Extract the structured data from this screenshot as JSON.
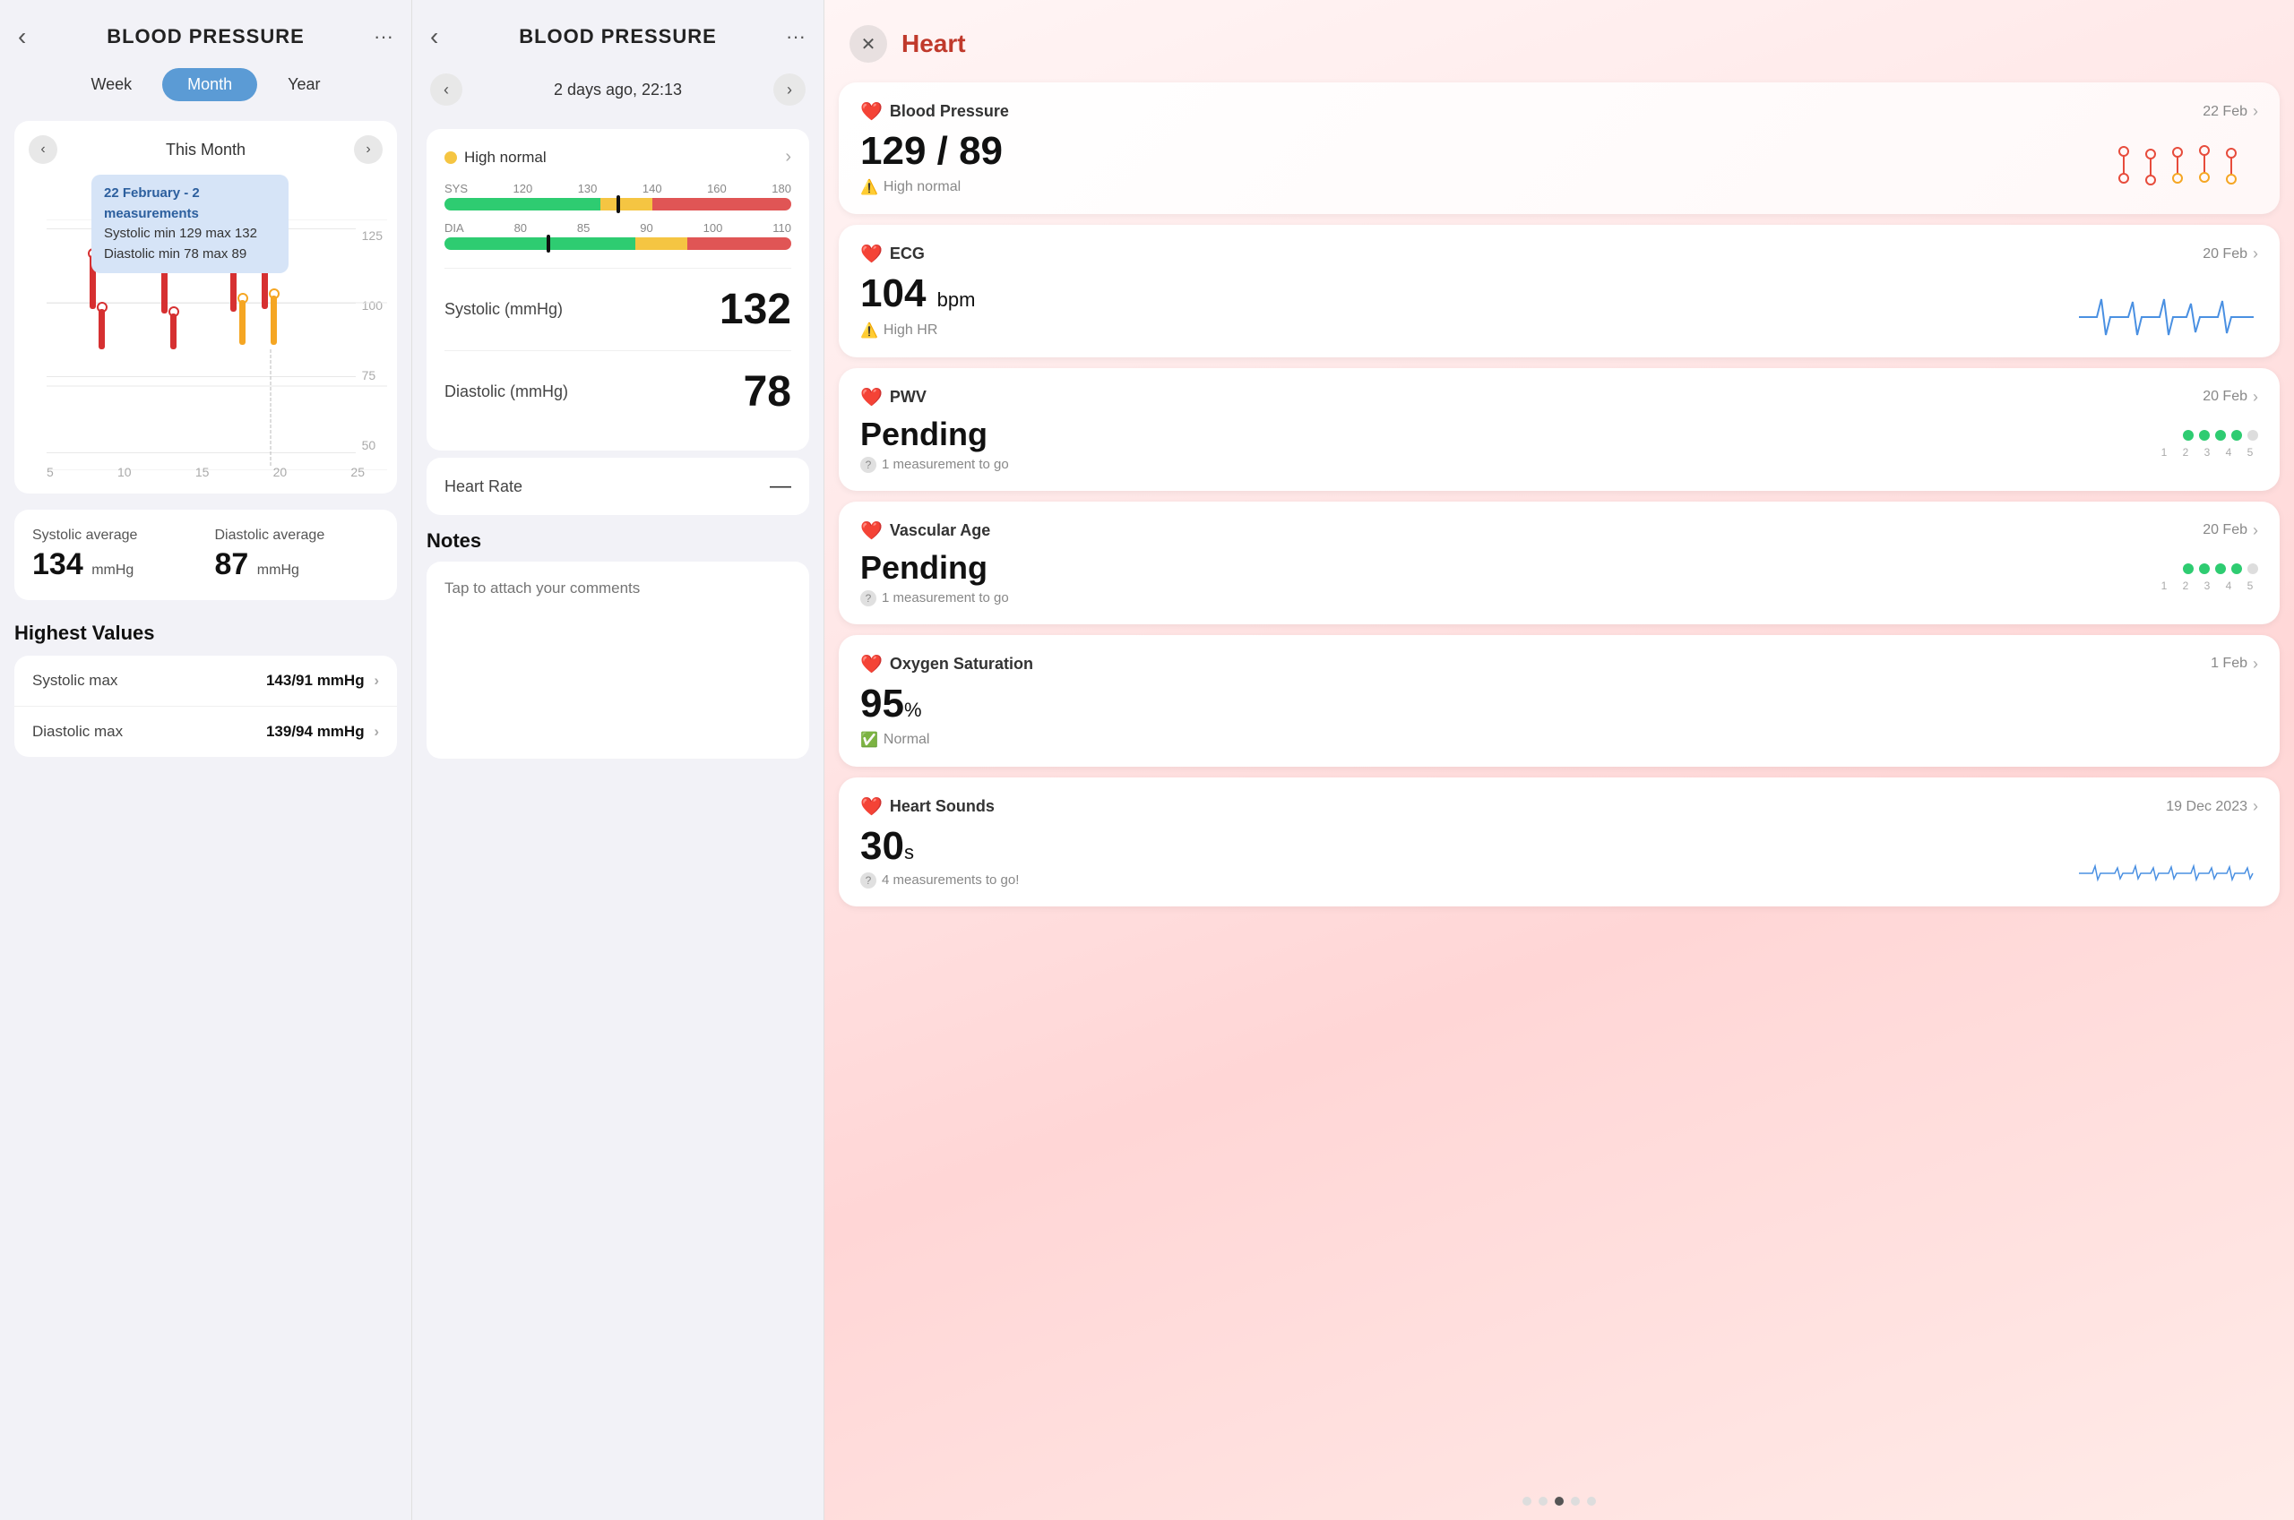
{
  "panel_left": {
    "back_label": "‹",
    "title": "BLOOD PRESSURE",
    "more_label": "···",
    "tabs": [
      {
        "label": "Week",
        "active": false
      },
      {
        "label": "Month",
        "active": true
      },
      {
        "label": "Year",
        "active": false
      }
    ],
    "chart_prev": "‹",
    "chart_next": "›",
    "chart_title": "This Month",
    "tooltip": {
      "date": "22 February - 2 measurements",
      "systolic": "Systolic min 129 max 132",
      "diastolic": "Diastolic min 78 max 89"
    },
    "y_labels": [
      "125",
      "100",
      "75",
      "50"
    ],
    "x_labels": [
      "5",
      "10",
      "15",
      "20",
      "25"
    ],
    "stats": {
      "systolic_label": "Systolic average",
      "systolic_value": "134",
      "systolic_unit": "mmHg",
      "diastolic_label": "Diastolic average",
      "diastolic_value": "87",
      "diastolic_unit": "mmHg"
    },
    "highest_title": "Highest Values",
    "highest_rows": [
      {
        "label": "Systolic max",
        "value": "143/91 mmHg"
      },
      {
        "label": "Diastolic max",
        "value": "139/94 mmHg"
      }
    ]
  },
  "panel_middle": {
    "back_label": "‹",
    "title": "BLOOD PRESSURE",
    "more_label": "···",
    "nav_prev": "‹",
    "nav_next": "›",
    "nav_date": "2 days ago, 22:13",
    "status_label": "High normal",
    "sys_label": "SYS",
    "dia_label": "DIA",
    "gauge_sys_ticks": [
      "80",
      "85",
      "90",
      "100",
      "110"
    ],
    "gauge_dia_ticks": [
      "120",
      "130",
      "140",
      "160",
      "180"
    ],
    "systolic_label": "Systolic (mmHg)",
    "systolic_value": "132",
    "diastolic_label": "Diastolic (mmHg)",
    "diastolic_value": "78",
    "heart_rate_label": "Heart Rate",
    "heart_rate_value": "—",
    "notes_title": "Notes",
    "notes_placeholder": "Tap to attach your comments"
  },
  "panel_right": {
    "close_label": "✕",
    "title": "Heart",
    "metrics": [
      {
        "id": "blood-pressure",
        "icon": "❤️",
        "name": "Blood Pressure",
        "date": "22 Feb",
        "value": "129 / 89",
        "status_icon": "⚠️",
        "status": "High normal",
        "has_chart": true
      },
      {
        "id": "ecg",
        "icon": "❤️",
        "name": "ECG",
        "date": "20 Feb",
        "value": "104",
        "unit": "bpm",
        "status_icon": "⚠️",
        "status": "High HR",
        "has_wave": true
      },
      {
        "id": "pwv",
        "icon": "❤️",
        "name": "PWV",
        "date": "20 Feb",
        "value": "Pending",
        "info": "1 measurement to go",
        "dots_filled": 4,
        "dots_total": 5,
        "dot_labels": [
          "1",
          "2",
          "3",
          "4",
          "5"
        ]
      },
      {
        "id": "vascular-age",
        "icon": "❤️",
        "name": "Vascular Age",
        "date": "20 Feb",
        "value": "Pending",
        "info": "1 measurement to go",
        "dots_filled": 4,
        "dots_total": 5,
        "dot_labels": [
          "1",
          "2",
          "3",
          "4",
          "5"
        ]
      },
      {
        "id": "oxygen-saturation",
        "icon": "❤️",
        "name": "Oxygen Saturation",
        "date": "1 Feb",
        "value": "95",
        "unit": "%",
        "status_icon": "✅",
        "status": "Normal"
      },
      {
        "id": "heart-sounds",
        "icon": "❤️",
        "name": "Heart Sounds",
        "date": "19 Dec 2023",
        "value": "30",
        "unit": "s",
        "info": "4 measurements to go!",
        "has_wave": true
      }
    ],
    "page_dots": [
      false,
      false,
      true,
      false,
      false
    ]
  }
}
